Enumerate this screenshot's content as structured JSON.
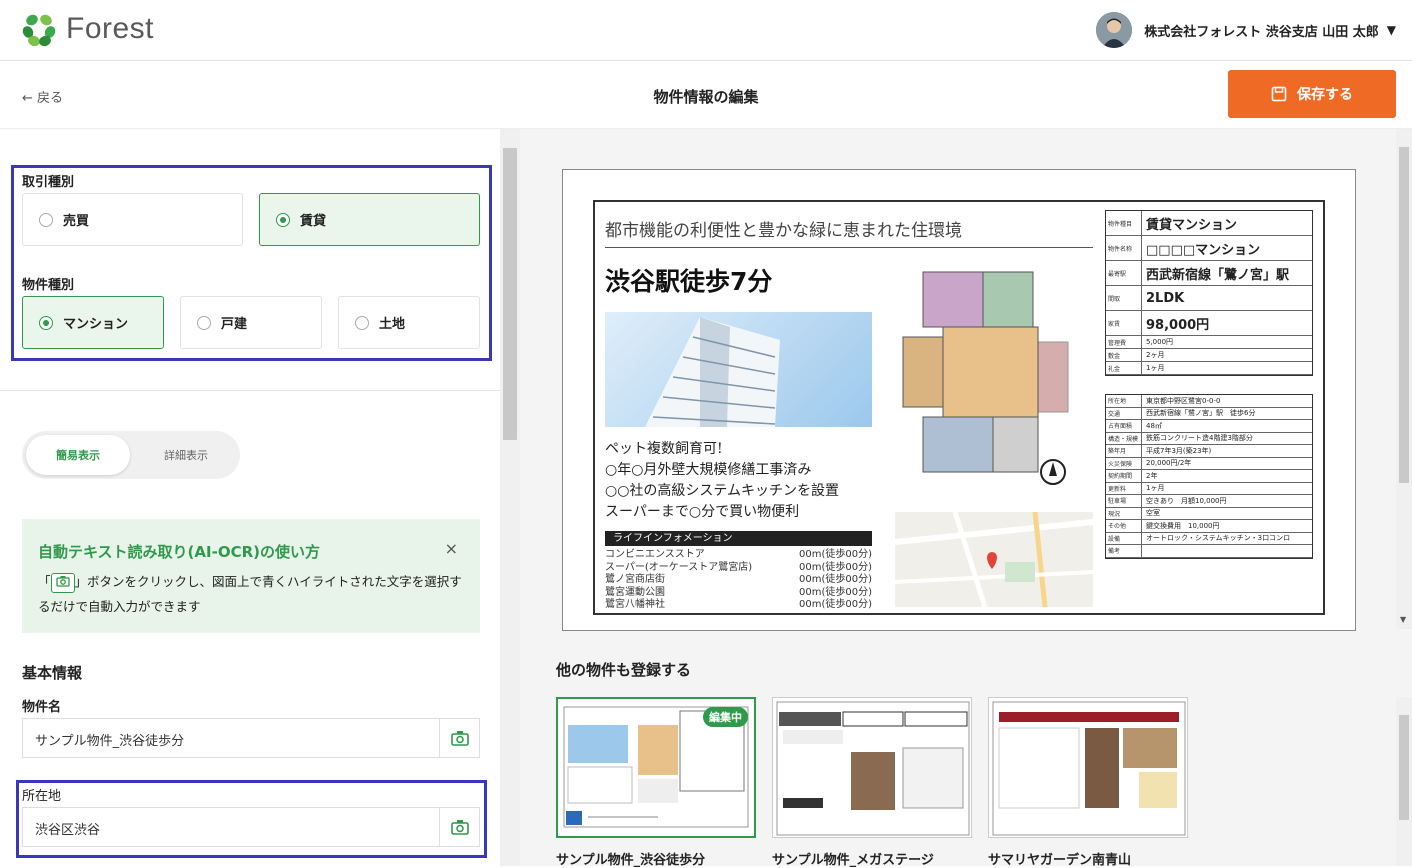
{
  "header": {
    "logo_text": "Forest",
    "user_name": "株式会社フォレスト 渋谷支店 山田 太郎",
    "caret": "▼"
  },
  "subbar": {
    "back_label": "← 戻る",
    "title": "物件情報の編集",
    "save_label": "保存する"
  },
  "transaction": {
    "label": "取引種別",
    "options": [
      {
        "label": "売買",
        "selected": false
      },
      {
        "label": "賃貸",
        "selected": true
      }
    ]
  },
  "property_type": {
    "label": "物件種別",
    "options": [
      {
        "label": "マンション",
        "selected": true
      },
      {
        "label": "戸建",
        "selected": false
      },
      {
        "label": "土地",
        "selected": false
      }
    ]
  },
  "view_toggle": {
    "simple": "簡易表示",
    "detail": "詳細表示"
  },
  "ocr": {
    "title": "自動テキスト読み取り(AI-OCR)の使い方",
    "close": "×",
    "text_before": "「",
    "text_after": "」ボタンをクリックし、図面上で青くハイライトされた文字を選択するだけで自動入力ができます"
  },
  "basic": {
    "section": "基本情報",
    "name_label": "物件名",
    "name_value": "サンプル物件_渋谷徒歩分",
    "address_label": "所在地",
    "address_value": "渋谷区渋谷"
  },
  "flyer": {
    "headline": "都市機能の利便性と豊かな緑に恵まれた住環境",
    "station": "渋谷駅徒歩7分",
    "pet": "ペット複数飼育可!",
    "lines": [
      "○年○月外壁大規模修繕工事済み",
      "○○社の高級システムキッチンを設置",
      "スーパーまで○分で買い物便利"
    ],
    "lifeinfo_title": "ライフインフォメーション",
    "lifeinfo": [
      {
        "name": "コンビニエンスストア",
        "dist": "00m(徒歩00分)"
      },
      {
        "name": "スーパー(オーケーストア鷺宮店)",
        "dist": "00m(徒歩00分)"
      },
      {
        "name": "鷺ノ宮商店街",
        "dist": "00m(徒歩00分)"
      },
      {
        "name": "鷺宮運動公園",
        "dist": "00m(徒歩00分)"
      },
      {
        "name": "鷺宮八幡神社",
        "dist": "00m(徒歩00分)"
      }
    ],
    "table": [
      {
        "k": "物件種目",
        "v": "賃貸マンション"
      },
      {
        "k": "物件名称",
        "v": "□□□□マンション"
      },
      {
        "k": "最寄駅",
        "v": "西武新宿線「鷺ノ宮」駅"
      },
      {
        "k": "間取",
        "v": "2LDK"
      },
      {
        "k": "家賃",
        "v": "98,000円"
      },
      {
        "k": "管理費",
        "v": "5,000円"
      },
      {
        "k": "敷金",
        "v": "2ヶ月"
      },
      {
        "k": "礼金",
        "v": "1ヶ月"
      }
    ],
    "table2": [
      {
        "k": "所在地",
        "v": "東京都中野区鷺宮0-0-0"
      },
      {
        "k": "交通",
        "v": "西武新宿線「鷺ノ宮」駅　徒歩6分"
      },
      {
        "k": "占有面積",
        "v": "48㎡"
      },
      {
        "k": "構造・規模",
        "v": "鉄筋コンクリート造4階建3階部分"
      },
      {
        "k": "築年月",
        "v": "平成7年3月(築23年)"
      },
      {
        "k": "火災保険",
        "v": "20,000円/2年"
      },
      {
        "k": "契約期間",
        "v": "2年"
      },
      {
        "k": "更新料",
        "v": "1ヶ月"
      },
      {
        "k": "駐車場",
        "v": "空きあり　月額10,000円"
      },
      {
        "k": "現況",
        "v": "空室"
      },
      {
        "k": "その他",
        "v": "鍵交換費用　10,000円"
      },
      {
        "k": "設備",
        "v": "オートロック・システムキッチン・3口コンロ"
      },
      {
        "k": "備考",
        "v": ""
      }
    ]
  },
  "others": {
    "title": "他の物件も登録する",
    "items": [
      {
        "name": "サンプル物件_渋谷徒歩分",
        "badge": "編集中"
      },
      {
        "name": "サンプル物件_メガステージ"
      },
      {
        "name": "サマリヤガーデン南青山"
      }
    ]
  },
  "colors": {
    "accent": "#2e9a4a",
    "save": "#ef6a25",
    "highlight": "#3939b8"
  }
}
